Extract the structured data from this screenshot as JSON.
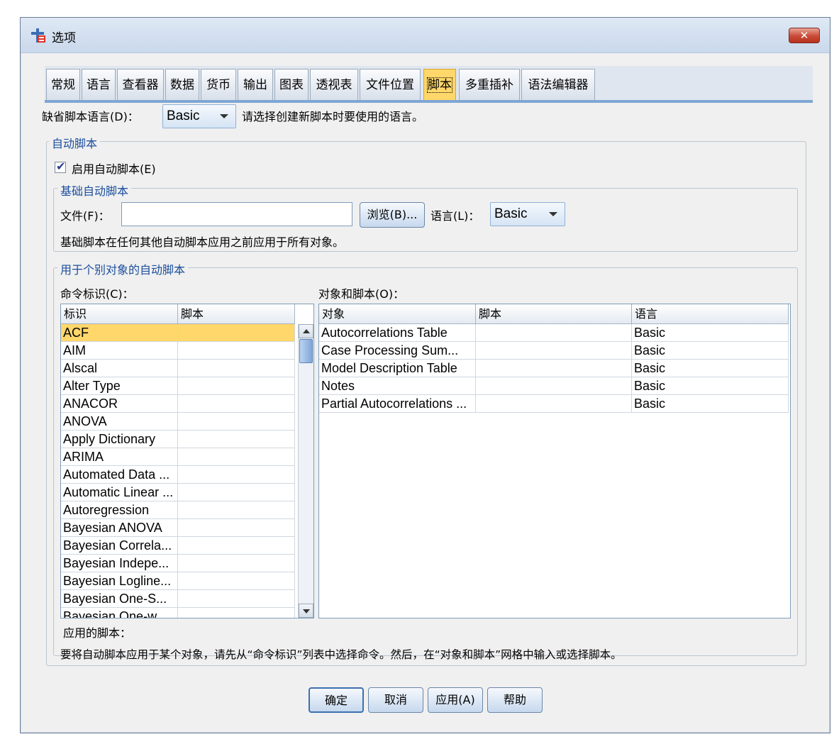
{
  "window": {
    "title": "选项",
    "close_label": "✕"
  },
  "tabs": [
    {
      "label": "常规"
    },
    {
      "label": "语言"
    },
    {
      "label": "查看器"
    },
    {
      "label": "数据"
    },
    {
      "label": "货币"
    },
    {
      "label": "输出"
    },
    {
      "label": "图表"
    },
    {
      "label": "透视表"
    },
    {
      "label": "文件位置"
    },
    {
      "label": "脚本",
      "active": true
    },
    {
      "label": "多重插补"
    },
    {
      "label": "语法编辑器"
    }
  ],
  "default_script": {
    "label": "缺省脚本语言(D)：",
    "value": "Basic",
    "hint": "请选择创建新脚本时要使用的语言。"
  },
  "autoscripts": {
    "legend": "自动脚本",
    "enable_label": "启用自动脚本(E)",
    "enabled": true,
    "base": {
      "legend": "基础自动脚本",
      "file_label": "文件(F)：",
      "file_value": "",
      "browse_label": "浏览(B)...",
      "language_label": "语言(L)：",
      "language_value": "Basic",
      "note": "基础脚本在任何其他自动脚本应用之前应用于所有对象。"
    },
    "individual": {
      "legend": "用于个别对象的自动脚本",
      "command_label": "命令标识(C)：",
      "objects_label": "对象和脚本(O)：",
      "commands_header": [
        "标识",
        "脚本"
      ],
      "commands": [
        "ACF",
        "AIM",
        "Alscal",
        "Alter Type",
        "ANACOR",
        "ANOVA",
        "Apply Dictionary",
        "ARIMA",
        "Automated Data ...",
        "Automatic Linear ...",
        "Autoregression",
        "Bayesian ANOVA",
        "Bayesian Correla...",
        "Bayesian Indepe...",
        "Bayesian Logline...",
        "Bayesian One-S...",
        "Bayesian One-w..."
      ],
      "selected_command": "ACF",
      "objects_header": [
        "对象",
        "脚本",
        "语言"
      ],
      "objects": [
        {
          "object": "Autocorrelations Table",
          "script": "",
          "language": "Basic"
        },
        {
          "object": "Case Processing Sum...",
          "script": "",
          "language": "Basic"
        },
        {
          "object": "Model Description Table",
          "script": "",
          "language": "Basic"
        },
        {
          "object": "Notes",
          "script": "",
          "language": "Basic"
        },
        {
          "object": "Partial Autocorrelations ...",
          "script": "",
          "language": "Basic"
        }
      ],
      "applied_label": "应用的脚本：",
      "instructions": "要将自动脚本应用于某个对象，请先从“命令标识”列表中选择命令。然后，在“对象和脚本”网格中输入或选择脚本。"
    }
  },
  "buttons": {
    "ok": "确定",
    "cancel": "取消",
    "apply": "应用(A)",
    "help": "帮助"
  }
}
